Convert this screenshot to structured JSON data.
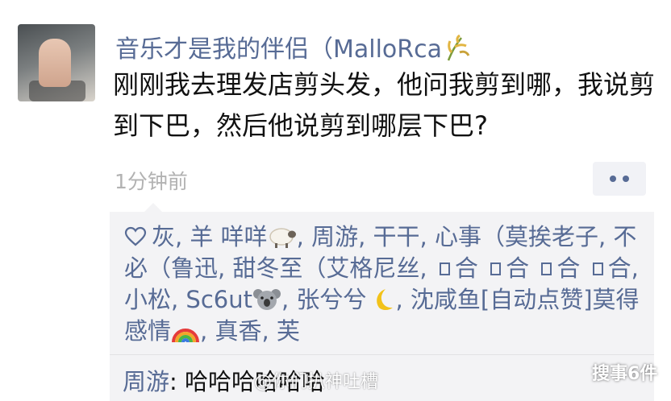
{
  "post": {
    "author": "音乐才是我的伴侣（MalloRca",
    "author_icon": "rice-plant-icon",
    "text": "刚刚我去理发店剪头发，他问我剪到哪，我说剪到下巴，然后他说剪到哪层下巴?",
    "time": "1分钟前",
    "more_icon": "more-dots-icon"
  },
  "likes": {
    "icon": "heart-outline-icon",
    "seg1": "灰, 羊 咩咩",
    "emoji1": "sheep-emoji",
    "seg2": ", 周游, 干干, 心事（莫挨老子, 不必（鲁迅, 甜冬至（艾格尼丝, ",
    "g1": "合",
    "g2": "合",
    "g3": "合",
    "g4": "合",
    "seg3": ", 小松, Sc6ut",
    "emoji2": "koala-emoji",
    "seg4": ", 张兮兮",
    "emoji3": "crescent-moon-emoji",
    "seg5": ", 沈咸鱼[自动点赞]莫得感情",
    "emoji4": "rainbow-emoji",
    "seg6": ", 真香, 芙"
  },
  "comment": {
    "author": "周游",
    "sep": ": ",
    "text": "哈哈哈哈哈哈"
  },
  "watermarks": {
    "center": "@你们扒神吐槽",
    "corner": "搜事6件"
  },
  "colors": {
    "link": "#576b95",
    "panel": "#f3f3f5",
    "time": "#b2b2b2"
  }
}
